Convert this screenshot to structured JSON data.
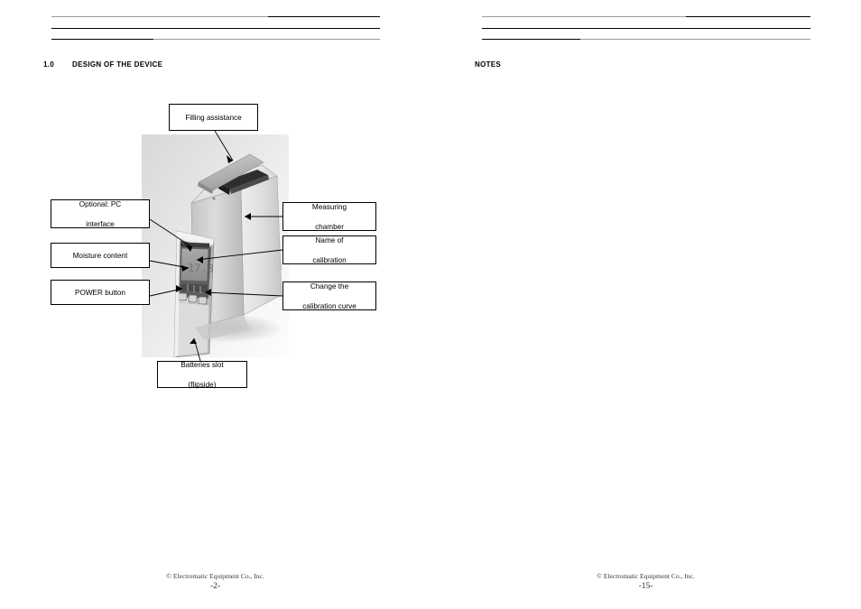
{
  "document": {
    "left_page": {
      "section_number": "1.0",
      "section_title": "DESIGN OF THE DEVICE",
      "footer_copyright": "© Electromatic Equipment Co., Inc.",
      "footer_page": "-2-",
      "callouts": [
        {
          "id": "filling-assistance",
          "line1": "Filling assistance",
          "line2": ""
        },
        {
          "id": "optional-pc-interface",
          "line1": "Optional: PC",
          "line2": "interface"
        },
        {
          "id": "moisture-content",
          "line1": "Moisture content",
          "line2": ""
        },
        {
          "id": "power-button",
          "line1": "POWER button",
          "line2": ""
        },
        {
          "id": "batteries-slot",
          "line1": "Batteries slot",
          "line2": "(flipside)"
        },
        {
          "id": "measuring-chamber",
          "line1": "Measuring",
          "line2": "chamber"
        },
        {
          "id": "name-of-calibration",
          "line1": "Name of",
          "line2": "calibration"
        },
        {
          "id": "change-calibration-curve",
          "line1": "Change the",
          "line2": "calibration curve"
        }
      ],
      "photo_alt": "moisture-meter-device-photo",
      "meter_display_value": "17.3"
    },
    "right_page": {
      "section_title": "NOTES",
      "footer_copyright": "© Electromatic Equipment Co., Inc.",
      "footer_page": "-15-"
    },
    "colors": {
      "rule_black": "#000000",
      "rule_gray": "#9a9a9a",
      "text": "#000000",
      "footer_text": "#3a3a3a"
    }
  }
}
